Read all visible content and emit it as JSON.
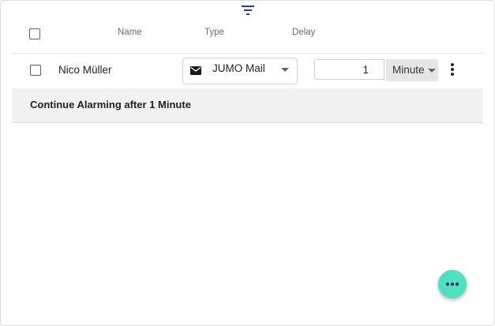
{
  "toolbar": {
    "filter_icon": "filter-list-icon",
    "filter_color": "#2d3a7c"
  },
  "table": {
    "headers": {
      "name": "Name",
      "type": "Type",
      "delay": "Delay"
    },
    "rows": [
      {
        "name": "Nico Müller",
        "type": {
          "icon": "mail-icon",
          "label": "JUMO Mail"
        },
        "delay": {
          "value": "1",
          "unit": "Minute"
        },
        "checked": false
      }
    ]
  },
  "summary": {
    "text": "Continue Alarming after 1 Minute"
  },
  "fab": {
    "icon": "more-horizontal-icon",
    "color": "#4fe0bf"
  }
}
